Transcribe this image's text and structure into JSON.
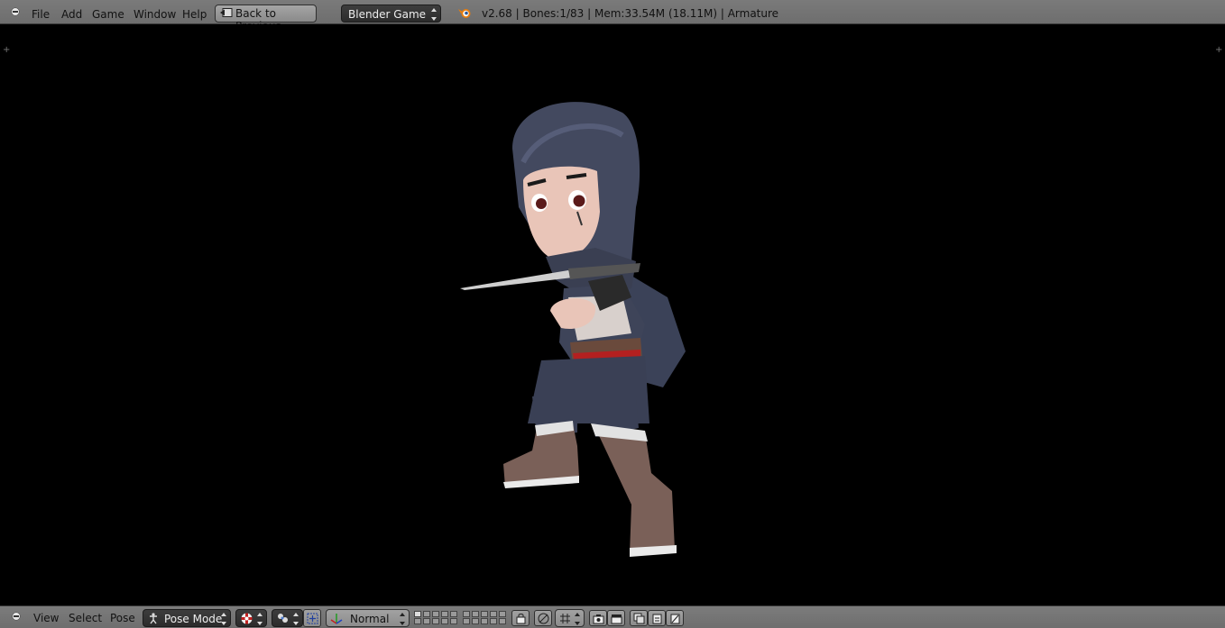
{
  "header": {
    "menu": [
      {
        "label": "File"
      },
      {
        "label": "Add"
      },
      {
        "label": "Game"
      },
      {
        "label": "Window"
      },
      {
        "label": "Help"
      }
    ],
    "back_button_label": "Back to Previous",
    "engine_selector": "Blender Game",
    "status": "v2.68 | Bones:1/83  | Mem:33.54M (18.11M) | Armature"
  },
  "viewport": {
    "background_color": "#000000",
    "content": "armature-character-model"
  },
  "footer": {
    "menu": [
      {
        "label": "View"
      },
      {
        "label": "Select"
      },
      {
        "label": "Pose"
      }
    ],
    "mode_selector": "Pose Mode",
    "transform_orientation": "Normal"
  },
  "colors": {
    "header_bg": "#737373",
    "dark_dropdown": "#333333",
    "accent_orange": "#e87d0d"
  }
}
